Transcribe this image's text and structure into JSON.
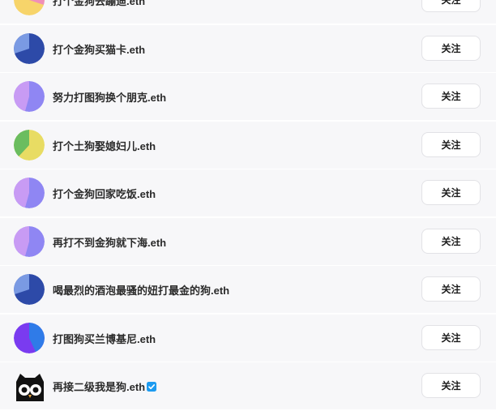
{
  "users": [
    {
      "name": "打个金狗去蹦迪.eth",
      "follow_label": "关注",
      "avatar_icon": "avatar-yellow-pink",
      "verified": false
    },
    {
      "name": "打个金狗买猫卡.eth",
      "follow_label": "关注",
      "avatar_icon": "avatar-blue",
      "verified": false
    },
    {
      "name": "努力打图狗换个朋克.eth",
      "follow_label": "关注",
      "avatar_icon": "avatar-lavender",
      "verified": false
    },
    {
      "name": "打个土狗娶媳妇儿.eth",
      "follow_label": "关注",
      "avatar_icon": "avatar-green-yellow",
      "verified": false
    },
    {
      "name": "打个金狗回家吃饭.eth",
      "follow_label": "关注",
      "avatar_icon": "avatar-lavender",
      "verified": false
    },
    {
      "name": "再打不到金狗就下海.eth",
      "follow_label": "关注",
      "avatar_icon": "avatar-lavender",
      "verified": false
    },
    {
      "name": "喝最烈的酒泡最骚的妞打最金的狗.eth",
      "follow_label": "关注",
      "avatar_icon": "avatar-blue",
      "verified": false
    },
    {
      "name": "打图狗买兰博基尼.eth",
      "follow_label": "关注",
      "avatar_icon": "avatar-violet-blue",
      "verified": false
    },
    {
      "name": "再接二级我是狗.eth",
      "follow_label": "关注",
      "avatar_icon": "avatar-owl",
      "verified": true
    }
  ],
  "colors": {
    "row_background": "#f7f7f9",
    "verified_badge": "#1d9bf0"
  }
}
